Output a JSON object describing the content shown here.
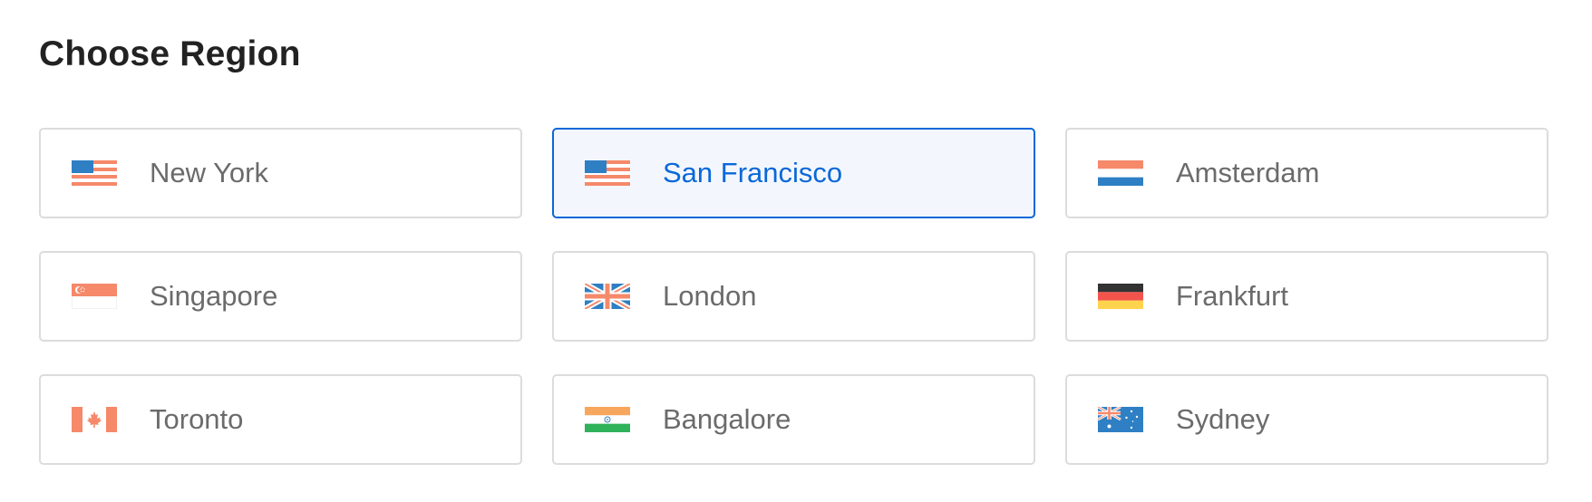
{
  "header": {
    "title": "Choose Region"
  },
  "regions": [
    {
      "label": "New York",
      "flag": "usa-flag-icon",
      "selected": false
    },
    {
      "label": "San Francisco",
      "flag": "usa-flag-icon",
      "selected": true
    },
    {
      "label": "Amsterdam",
      "flag": "netherlands-flag-icon",
      "selected": false
    },
    {
      "label": "Singapore",
      "flag": "singapore-flag-icon",
      "selected": false
    },
    {
      "label": "London",
      "flag": "uk-flag-icon",
      "selected": false
    },
    {
      "label": "Frankfurt",
      "flag": "germany-flag-icon",
      "selected": false
    },
    {
      "label": "Toronto",
      "flag": "canada-flag-icon",
      "selected": false
    },
    {
      "label": "Bangalore",
      "flag": "india-flag-icon",
      "selected": false
    },
    {
      "label": "Sydney",
      "flag": "australia-flag-icon",
      "selected": false
    }
  ],
  "colors": {
    "accent": "#0a68d8",
    "selected_background": "#f3f7fd",
    "card_border": "#dcdcdc",
    "label_text": "#6b6b6b",
    "title_text": "#222222"
  }
}
